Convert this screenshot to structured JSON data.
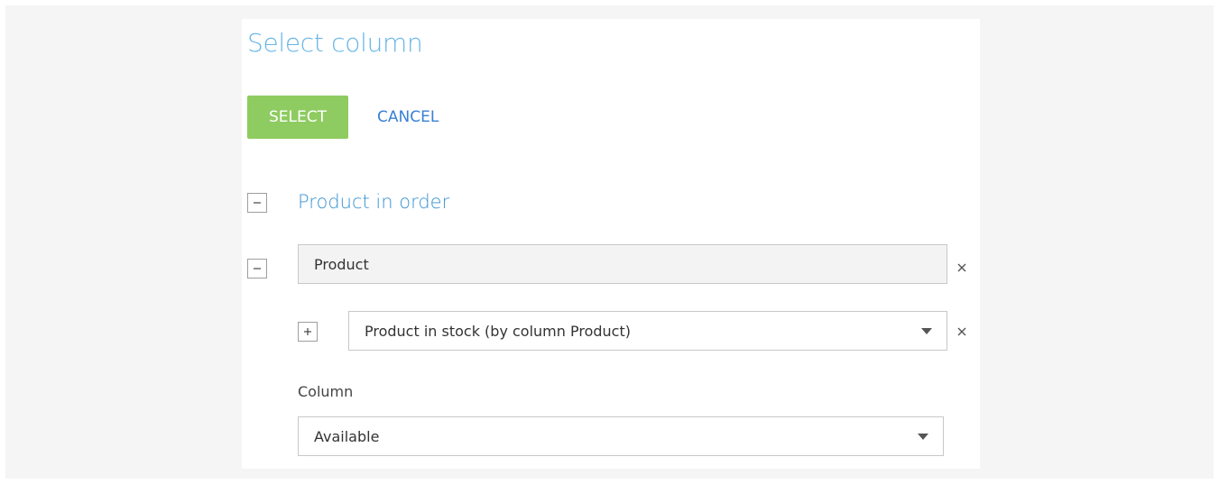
{
  "dialog": {
    "title": "Select column",
    "select_label": "SELECT",
    "cancel_label": "CANCEL"
  },
  "tree": {
    "root_label": "Product in order",
    "level1_value": "Product",
    "level2_value": "Product in stock (by column Product)",
    "column_label": "Column",
    "column_value": "Available"
  },
  "colors": {
    "accent": "#65b5e6",
    "select_button": "#8ecb60",
    "link": "#3a80d3"
  },
  "icons": {
    "collapse": "minus-icon",
    "expand": "plus-icon",
    "remove": "close-icon",
    "dropdown": "chevron-down-icon"
  }
}
